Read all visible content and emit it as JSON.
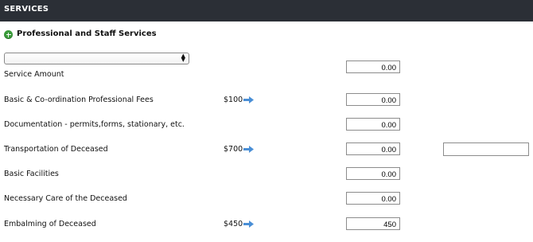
{
  "header": {
    "title": "SERVICES"
  },
  "section": {
    "title": "Professional and Staff Services"
  },
  "dropdown": {
    "selected": ""
  },
  "rows": [
    {
      "label": "Service Amount",
      "price": "",
      "value": "0.00"
    },
    {
      "label": "Basic & Co-ordination Professional Fees",
      "price": "$100",
      "value": "0.00"
    },
    {
      "label": "Documentation - permits,forms, stationary, etc.",
      "price": "",
      "value": "0.00"
    },
    {
      "label": "Transportation of Deceased",
      "price": "$700",
      "value": "0.00",
      "extra": ""
    },
    {
      "label": "Basic Facilities",
      "price": "",
      "value": "0.00"
    },
    {
      "label": "Necessary Care of the Deceased",
      "price": "",
      "value": "0.00"
    },
    {
      "label": "Embalming of Deceased",
      "price": "$450",
      "value": "450"
    }
  ],
  "icons": {
    "add": "plus-circle-icon",
    "apply": "arrow-right-icon"
  },
  "colors": {
    "header_bg": "#2b2f36",
    "add_icon": "#3a9a3a",
    "arrow": "#4a8fd6"
  }
}
